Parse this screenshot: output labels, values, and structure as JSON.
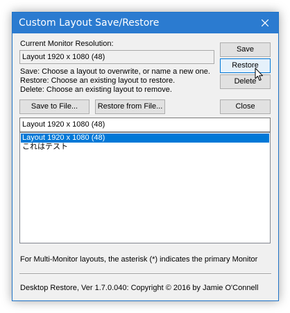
{
  "window": {
    "title": "Custom Layout Save/Restore"
  },
  "resolution": {
    "label": "Current Monitor Resolution:",
    "value": "Layout 1920 x 1080 (48)"
  },
  "help": {
    "save": "Save: Choose a layout to overwrite, or name a new one.",
    "restore": "Restore: Choose an existing layout to restore.",
    "delete": "Delete: Choose an existing layout to remove."
  },
  "buttons": {
    "save": "Save",
    "restore": "Restore",
    "delete": "Delete",
    "save_to_file": "Save to File...",
    "restore_from_file": "Restore from File...",
    "close": "Close"
  },
  "layout_name_input": {
    "value": "Layout 1920 x 1080 (48)"
  },
  "layouts": {
    "items": [
      {
        "label": "Layout 1920 x 1080 (48)",
        "selected": true
      },
      {
        "label": "これはテスト",
        "selected": false
      }
    ]
  },
  "footer": {
    "note": "For Multi-Monitor layouts, the asterisk (*) indicates the primary Monitor",
    "copyright": "Desktop Restore, Ver 1.7.0.040: Copyright © 2016 by Jamie O'Connell"
  },
  "colors": {
    "titlebar": "#2b7bd0",
    "selection": "#0078d7",
    "dialog_background": "#f0f0f0"
  }
}
